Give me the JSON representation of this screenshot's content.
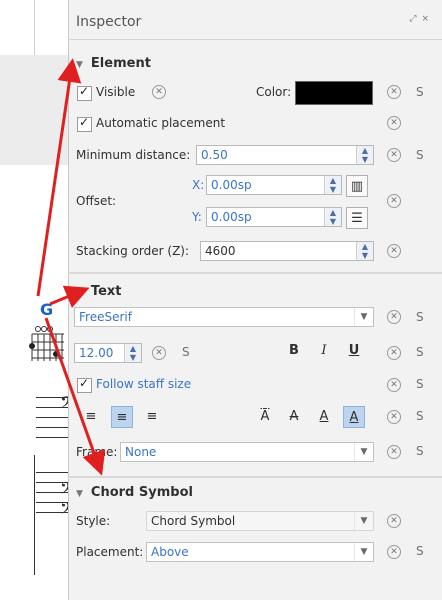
{
  "inspector": {
    "title": "Inspector",
    "title_buttons": [
      "⤢",
      "×"
    ],
    "element": {
      "heading": "Element",
      "visible_label": "Visible",
      "visible_checked": true,
      "color_label": "Color:",
      "color_value": "#000000",
      "auto_placement_label": "Automatic placement",
      "auto_placement_checked": true,
      "min_distance_label": "Minimum distance:",
      "min_distance_value": "0.50",
      "offset_label": "Offset:",
      "offset_x_label": "X:",
      "offset_x_value": "0.00sp",
      "offset_y_label": "Y:",
      "offset_y_value": "0.00sp",
      "stacking_label": "Stacking order (Z):",
      "stacking_value": "4600"
    },
    "text": {
      "heading": "Text",
      "font_value": "FreeSerif",
      "size_value": "12.00",
      "style_set_label": "S",
      "bold": "B",
      "italic": "I",
      "underline": "U",
      "follow_staff_label": "Follow staff size",
      "follow_staff_checked": true,
      "frame_label": "Frame:",
      "frame_value": "None",
      "align_icons": [
        "align-left-icon",
        "align-center-icon",
        "align-right-icon"
      ],
      "valign_icons": [
        "Ā",
        "A",
        "A",
        "A"
      ]
    },
    "chord_symbol": {
      "heading": "Chord Symbol",
      "style_label": "Style:",
      "style_value": "Chord Symbol",
      "placement_label": "Placement:",
      "placement_value": "Above"
    }
  },
  "score": {
    "chord_letter": "G"
  },
  "colors": {
    "accent": "#3a74c7",
    "arrow": "#e02020",
    "active_button": "#bcd4ef"
  }
}
